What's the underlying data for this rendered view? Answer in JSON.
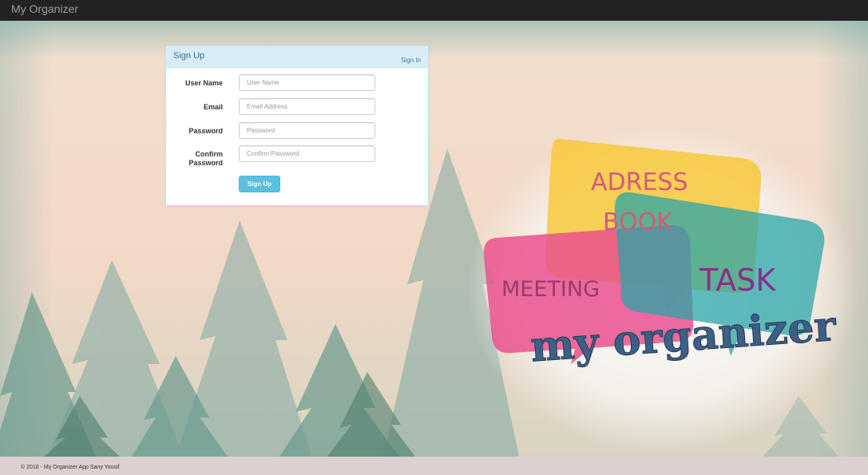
{
  "navbar": {
    "brand": "My Organizer"
  },
  "signup": {
    "title": "Sign Up",
    "signin_link": "Sign In",
    "fields": [
      {
        "label": "User Name",
        "placeholder": "User Name",
        "value": ""
      },
      {
        "label": "Email",
        "placeholder": "Email Address",
        "value": ""
      },
      {
        "label": "Password",
        "placeholder": "Password",
        "value": ""
      },
      {
        "label": "Confirm Password",
        "placeholder": "Confirm Password",
        "value": ""
      }
    ],
    "submit_label": "Sign Up"
  },
  "logo": {
    "bubble_yellow_text_1": "ADRESS",
    "bubble_yellow_text_2": "BOOK",
    "bubble_pink_text": "MEETING",
    "bubble_teal_text": "TASK",
    "wordmark": "my organizer"
  },
  "colors": {
    "navbar": "#222222",
    "panel_heading": "#d9edf7",
    "button": "#5bc0de",
    "bubble_yellow": "#f7c93a",
    "bubble_pink": "#e9518e",
    "bubble_teal": "#2aa5a7",
    "footer": "#dcd1cf"
  },
  "footer": {
    "text": "© 2018 - My Organizer App Sany Yousif"
  }
}
